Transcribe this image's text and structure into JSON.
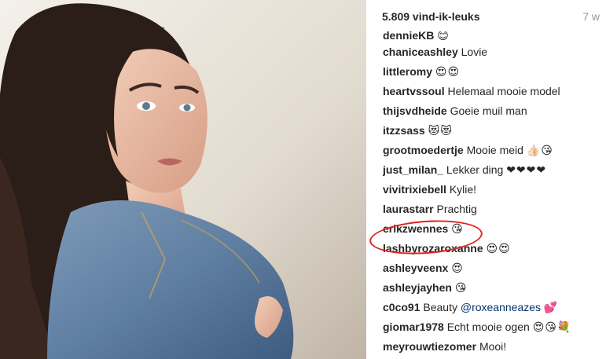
{
  "header": {
    "likes": "5.809 vind-ik-leuks",
    "age": "7 w"
  },
  "comments": [
    {
      "user": "dennieKB",
      "text": "",
      "emoji": "😊"
    },
    {
      "user": "chaniceashley",
      "text": "Lovie",
      "emoji": ""
    },
    {
      "user": "littleromy",
      "text": "",
      "emoji": "😍😍"
    },
    {
      "user": "heartvssoul",
      "text": "Helemaal mooie model",
      "emoji": ""
    },
    {
      "user": "thijsvdheide",
      "text": "Goeie muil man",
      "emoji": ""
    },
    {
      "user": "itzzsass",
      "text": "",
      "emoji": "😻😻"
    },
    {
      "user": "grootmoedertje",
      "text": "Mooie meid",
      "emoji": "👍🏻😘"
    },
    {
      "user": "just_milan_",
      "text": "Lekker ding",
      "emoji": "❤❤❤❤"
    },
    {
      "user": "vivitrixiebell",
      "text": "Kylie!",
      "emoji": ""
    },
    {
      "user": "laurastarr",
      "text": "Prachtig",
      "emoji": ""
    },
    {
      "user": "erikzwennes",
      "text": "",
      "emoji": "😘"
    },
    {
      "user": "lashbyrozaroxanne",
      "text": "",
      "emoji": "😍😍"
    },
    {
      "user": "ashleyveenx",
      "text": "",
      "emoji": "😍"
    },
    {
      "user": "ashleyjayhen",
      "text": "",
      "emoji": "😘"
    },
    {
      "user": "c0co91",
      "text": "Beauty",
      "mention": "@roxeanneazes",
      "emoji": "💕"
    },
    {
      "user": "giomar1978",
      "text": "Echt mooie ogen",
      "emoji": "😍😘💐"
    },
    {
      "user": "meyrouwtiezomer",
      "text": "Mooi!",
      "emoji": ""
    }
  ],
  "colors": {
    "highlight_circle": "#e0231f",
    "mention": "#003569"
  }
}
